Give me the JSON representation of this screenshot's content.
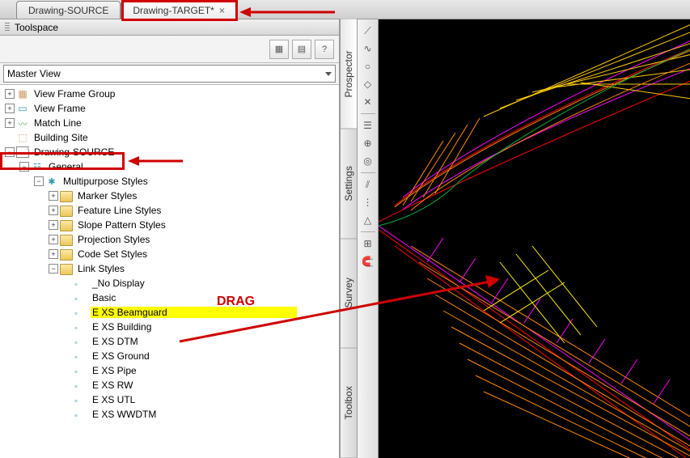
{
  "tabs": {
    "t0": {
      "label": "Drawing-SOURCE"
    },
    "t1": {
      "label": "Drawing-TARGET*"
    }
  },
  "toolspace": {
    "title": "Toolspace",
    "view": "Master View",
    "toolbar": {
      "b0": "▦",
      "b1": "▤",
      "help": "?"
    }
  },
  "tree": {
    "view_frame_group": "View Frame Group",
    "view_frame": "View Frame",
    "match_line": "Match Line",
    "building_site": "Building Site",
    "drawing_source": "Drawing-SOURCE",
    "general": "General",
    "multipurpose_styles": "Multipurpose Styles",
    "marker_styles": "Marker Styles",
    "feature_line_styles": "Feature Line Styles",
    "slope_pattern_styles": "Slope Pattern Styles",
    "projection_styles": "Projection Styles",
    "code_set_styles": "Code Set Styles",
    "link_styles": "Link Styles",
    "no_display": "_No Display",
    "basic": "Basic",
    "e_xs_beamguard": "E XS Beamguard",
    "e_xs_building": "E XS Building",
    "e_xs_dtm": "E XS DTM",
    "e_xs_ground": "E XS Ground",
    "e_xs_pipe": "E XS Pipe",
    "e_xs_rw": "E XS RW",
    "e_xs_utl": "E XS UTL",
    "e_xs_wwdtm": "E XS WWDTM"
  },
  "sidetabs": {
    "prospector": "Prospector",
    "settings": "Settings",
    "survey": "Survey",
    "toolbox": "Toolbox"
  },
  "annotations": {
    "drag": "DRAG"
  }
}
